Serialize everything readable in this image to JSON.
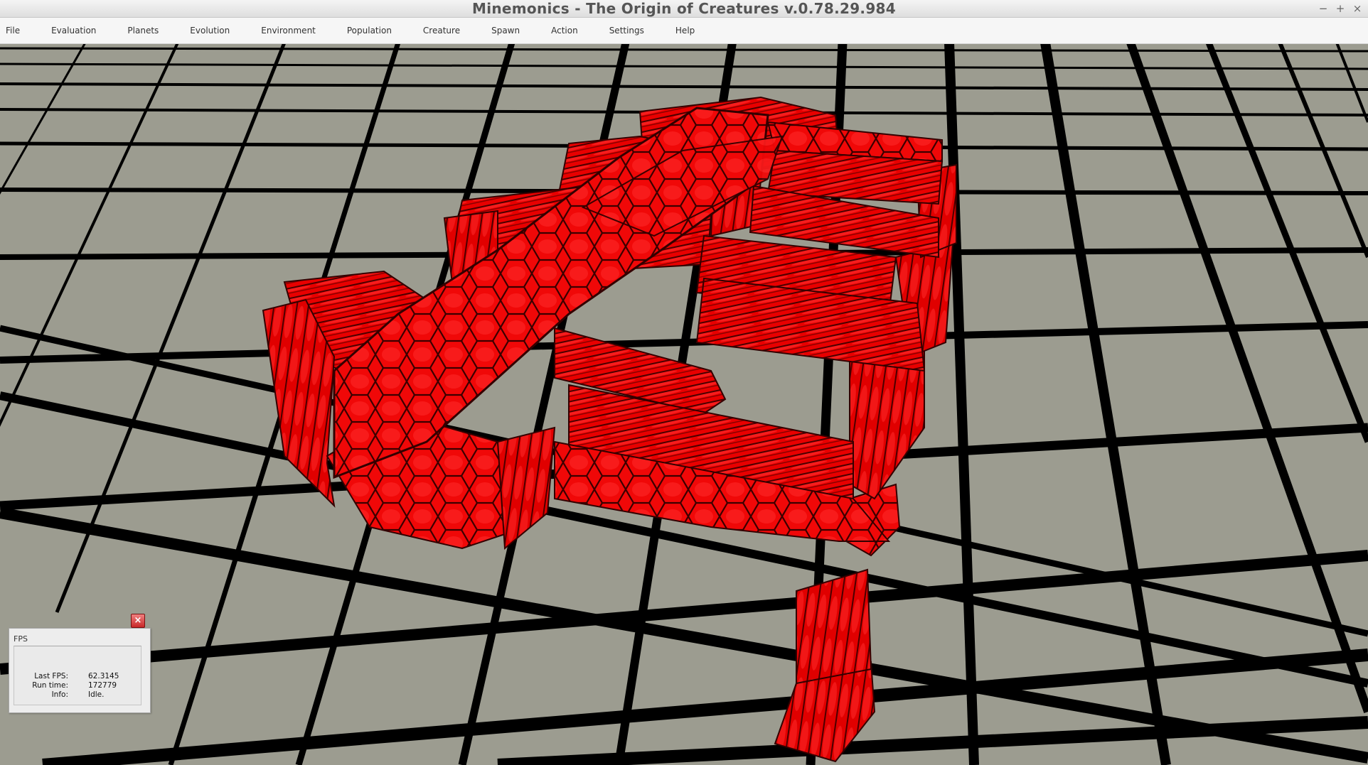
{
  "window": {
    "title": "Minemonics - The Origin of Creatures v.0.78.29.984",
    "minimize_glyph": "−",
    "maximize_glyph": "+",
    "close_glyph": "×"
  },
  "menu": {
    "items": [
      "File",
      "Evaluation",
      "Planets",
      "Evolution",
      "Environment",
      "Population",
      "Creature",
      "Spawn",
      "Action",
      "Settings",
      "Help"
    ]
  },
  "scene": {
    "ground_color": "#9c9c90",
    "grid_line_color": "#000000",
    "creature_color": "#ff0a0a",
    "creature_pattern": "hexagon-scale-texture"
  },
  "fps_panel": {
    "title": "FPS",
    "close_icon": "close-icon",
    "rows": [
      {
        "label": "Last FPS:",
        "value": "62.3145"
      },
      {
        "label": "Run time:",
        "value": "172779"
      },
      {
        "label": "Info:",
        "value": "Idle."
      }
    ]
  }
}
